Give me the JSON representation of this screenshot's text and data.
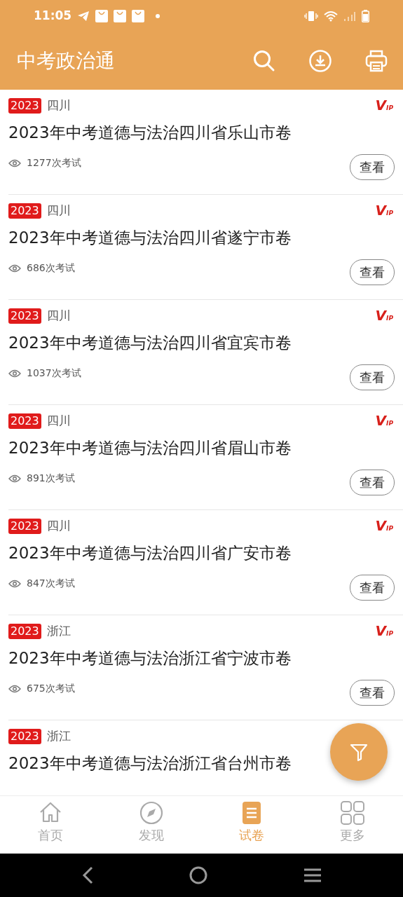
{
  "status_bar": {
    "time": "11:05"
  },
  "app_bar": {
    "title": "中考政治通"
  },
  "papers": [
    {
      "year": "2023",
      "region": "四川",
      "vip": "V$_{IP}$",
      "title": "2023年中考道德与法治四川省乐山市卷",
      "count": "1277次考试",
      "button": "查看"
    },
    {
      "year": "2023",
      "region": "四川",
      "vip": "V$_{IP}$",
      "title": "2023年中考道德与法治四川省遂宁市卷",
      "count": "686次考试",
      "button": "查看"
    },
    {
      "year": "2023",
      "region": "四川",
      "vip": "V$_{IP}$",
      "title": "2023年中考道德与法治四川省宜宾市卷",
      "count": "1037次考试",
      "button": "查看"
    },
    {
      "year": "2023",
      "region": "四川",
      "vip": "V$_{IP}$",
      "title": "2023年中考道德与法治四川省眉山市卷",
      "count": "891次考试",
      "button": "查看"
    },
    {
      "year": "2023",
      "region": "四川",
      "vip": "V$_{IP}$",
      "title": "2023年中考道德与法治四川省广安市卷",
      "count": "847次考试",
      "button": "查看"
    },
    {
      "year": "2023",
      "region": "浙江",
      "vip": "V$_{IP}$",
      "title": "2023年中考道德与法治浙江省宁波市卷",
      "count": "675次考试",
      "button": "查看"
    },
    {
      "year": "2023",
      "region": "浙江",
      "title": "2023年中考道德与法治浙江省台州市卷"
    }
  ],
  "bottom_nav": [
    {
      "label": "首页",
      "kind": "home",
      "selected": false
    },
    {
      "label": "发现",
      "kind": "compass",
      "selected": false
    },
    {
      "label": "试卷",
      "kind": "paper",
      "selected": true
    },
    {
      "label": "更多",
      "kind": "grid",
      "selected": false
    }
  ]
}
